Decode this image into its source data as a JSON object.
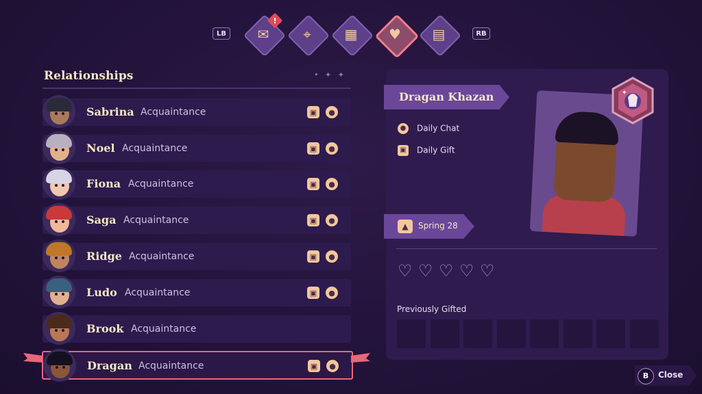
{
  "nav": {
    "left_bumper": "LB",
    "right_bumper": "RB",
    "tabs": [
      {
        "icon": "quest-scroll-icon",
        "glyph": "✉",
        "alert": "!"
      },
      {
        "icon": "map-icon",
        "glyph": "⌖"
      },
      {
        "icon": "calendar-icon",
        "glyph": "▦"
      },
      {
        "icon": "heart-icon",
        "glyph": "♥",
        "active": true
      },
      {
        "icon": "book-icon",
        "glyph": "▤"
      }
    ]
  },
  "relationships": {
    "title": "Relationships",
    "decoration": "• ✦ ✦",
    "rows": [
      {
        "name": "Sabrina",
        "status": "Acquaintance",
        "hair": "#2a2a3a",
        "skin": "#a77a5c",
        "has_icons": true
      },
      {
        "name": "Noel",
        "status": "Acquaintance",
        "hair": "#b8b0c0",
        "skin": "#e2b08a",
        "has_icons": true
      },
      {
        "name": "Fiona",
        "status": "Acquaintance",
        "hair": "#d8d4e4",
        "skin": "#f0c8b0",
        "has_icons": true
      },
      {
        "name": "Saga",
        "status": "Acquaintance",
        "hair": "#c83a3a",
        "skin": "#f0b898",
        "has_icons": true
      },
      {
        "name": "Ridge",
        "status": "Acquaintance",
        "hair": "#c07828",
        "skin": "#c08460",
        "has_icons": true
      },
      {
        "name": "Ludo",
        "status": "Acquaintance",
        "hair": "#3a6080",
        "skin": "#e0b090",
        "has_icons": true
      },
      {
        "name": "Brook",
        "status": "Acquaintance",
        "hair": "#4a2a1a",
        "skin": "#b87858",
        "has_icons": false
      },
      {
        "name": "Dragan",
        "status": "Acquaintance",
        "hair": "#141020",
        "skin": "#8a5638",
        "has_icons": true,
        "selected": true
      }
    ],
    "gift_glyph": "▣",
    "chat_glyph": "●"
  },
  "detail": {
    "name": "Dragan Khazan",
    "daily_chat": "Daily Chat",
    "daily_gift": "Daily Gift",
    "birthday": "Spring 28",
    "hearts_filled": 0,
    "hearts_total": 5,
    "previously_gifted_label": "Previously Gifted",
    "gift_slots": 8
  },
  "footer": {
    "close_key": "B",
    "close_label": "Close"
  },
  "colors": {
    "accent": "#e8677a",
    "banner": "#6a4799",
    "icon_fill": "#f3c79c"
  }
}
